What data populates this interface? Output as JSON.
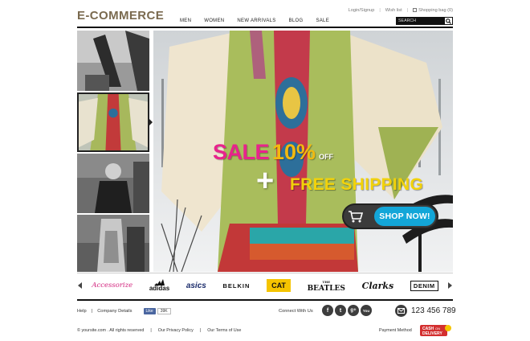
{
  "header": {
    "logo": "E-COMMERCE",
    "top_links": {
      "login": "Login/Signup",
      "wishlist": "Wish list",
      "bag": "Shopping bag (0)"
    },
    "nav": [
      "MEN",
      "WOMEN",
      "NEW ARRIVALS",
      "BLOG",
      "SALE"
    ],
    "search": {
      "placeholder": "SEARCH",
      "icon": "search-icon"
    }
  },
  "banner": {
    "sale": "SALE",
    "discount": "10%",
    "off": "OFF",
    "plus": "+",
    "shipping": "FREE SHIPPING",
    "shop_button": "SHOP NOW!",
    "colors": {
      "sale": "#e8238c",
      "discount": "#f2b90f",
      "shipping": "#f2d20a",
      "button": "#13a6d8"
    }
  },
  "brands": {
    "items": [
      {
        "id": "accessorize",
        "label": "Accessorize"
      },
      {
        "id": "adidas",
        "label": "adidas"
      },
      {
        "id": "asics",
        "label": "asics"
      },
      {
        "id": "belkin",
        "label": "BELKIN"
      },
      {
        "id": "cat",
        "label": "CAT"
      },
      {
        "id": "beatles",
        "label": "BEATLES",
        "small": "THE"
      },
      {
        "id": "clarks",
        "label": "Clarks"
      },
      {
        "id": "denim",
        "label": "DENIM"
      }
    ]
  },
  "footer": {
    "help": "Help",
    "company": "Company Details",
    "fb_like": "Like",
    "fb_count": "39K",
    "connect": "Connect With Us",
    "socials": [
      "f",
      "t",
      "g+",
      "You"
    ],
    "phone": "123 456 789",
    "copyright": "© yoursite.com . All rights reserved",
    "privacy": "Our Privacy Policy",
    "terms": "Our Terms of Use",
    "payment": "Payment Method",
    "cod_line1": "CASH",
    "cod_line2": "ON",
    "cod_line3": "DELIVERY"
  }
}
